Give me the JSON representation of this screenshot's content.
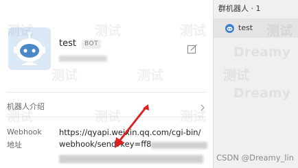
{
  "profile": {
    "name": "test",
    "badge": "BOT",
    "intro_label": "机器人介绍",
    "webhook_label_line1": "Webhook",
    "webhook_label_line2": "地址",
    "webhook_url_line1": "https://qyapi.weixin.qq.com/cgi-bin/",
    "webhook_url_line2": "webhook/send?key=ff8"
  },
  "group_list": {
    "header": "群机器人 · 1",
    "items": [
      {
        "name": "test"
      }
    ]
  },
  "watermark": {
    "text_cn": "测试",
    "text_en": "Dreamy"
  },
  "credit": "CSDN @Dreamy_lin",
  "colors": {
    "annotation_arrow": "#e02020",
    "selected_item_bg": "#e4e4e4",
    "avatar_bg": "#dbe9f7"
  },
  "icons": [
    "robot-avatar-icon",
    "edit-icon",
    "chevron-right-icon",
    "bot-chat-icon",
    "annotation-arrow"
  ]
}
